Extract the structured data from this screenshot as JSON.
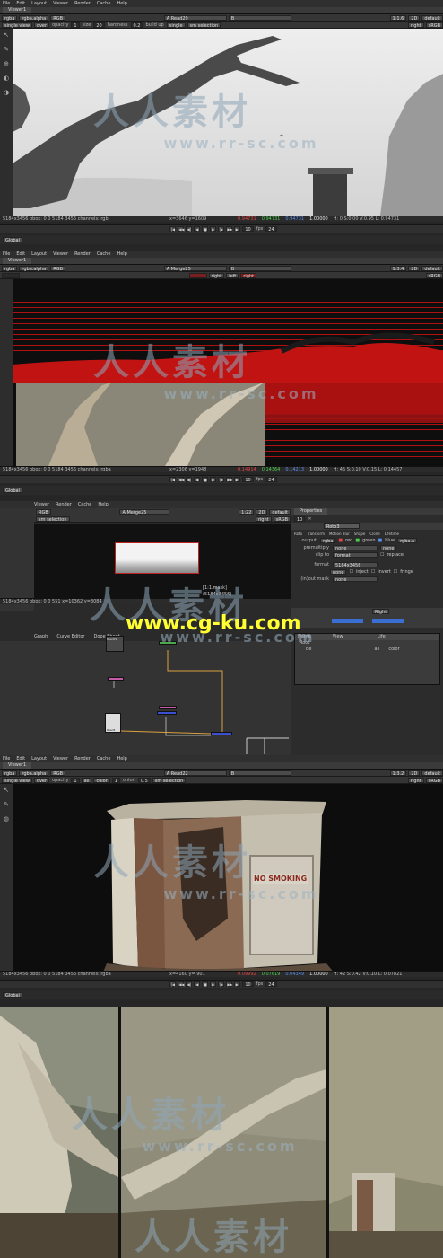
{
  "menu": [
    "File",
    "Edit",
    "Layout",
    "Viewer",
    "Render",
    "Cache",
    "Help"
  ],
  "viewer_tab": "Viewer1",
  "global_label": "Global",
  "fps_label": "fps",
  "fps_value": "24",
  "frame_value": "10",
  "panel1": {
    "row1": [
      "rgba",
      "rgba.alpha",
      "RGB"
    ],
    "input_a": "A  Read29",
    "input_b": "B",
    "zoom": "1:1.6",
    "view": "2D",
    "lut": "default",
    "row2": [
      "single view",
      "over",
      "opacity",
      "1",
      "size",
      "20",
      "hardness",
      "0.2",
      "build up",
      "single",
      "sm selection"
    ],
    "side": "right",
    "colorspace": "sRGB",
    "status_info": "5184x3456 bbox: 0 0 5184 3456 channels: rgb",
    "coords": "x=3646 y=1609",
    "pixel": [
      "0.94731",
      "0.94731",
      "0.94731",
      "1.00000"
    ],
    "hsvl": "H: 0 S:0.00 V:0.95  L: 0.94731"
  },
  "panel2": {
    "row1": [
      "rgba",
      "rgba.alpha",
      "RGB"
    ],
    "input_a": "A  Merge25",
    "input_b": "B",
    "zoom": "1:3.4",
    "view": "2D",
    "lut": "default",
    "side_labels": [
      "right",
      "left",
      "right"
    ],
    "colorspace": "sRGB",
    "status_info": "5184x3456 bbox: 0 0 5184 3456 channels: rgba",
    "coords": "x=2306 y=1948",
    "pixel": [
      "0.14914",
      "0.14364",
      "0.14213",
      "1.00000"
    ],
    "hsvl": "H: 45 S:0.10 V:0.15  L: 0.14457"
  },
  "panel3": {
    "row1": [
      "RGB"
    ],
    "input_a": "A  Merge25",
    "zoom": "1:22",
    "view": "2D",
    "lut": "default",
    "selection": "sm selection",
    "side": "right",
    "colorspace": "sRGB",
    "status_info": "5184x3456 bbox: 0 0 551 x=10362 y=3084",
    "node_tabs": [
      "Graph",
      "Curve Editor",
      "Dope Sheet"
    ],
    "mask_text": "[1:1.mask]",
    "mask_size": "(5184x3456)",
    "properties_title": "Properties",
    "properties_count": "10",
    "node_name": "Roto3",
    "prop_tabs": [
      "Roto",
      "Transform",
      "Motion Blur",
      "Shape",
      "Clone",
      "Lifetime"
    ],
    "output_label": "output",
    "output_value": "rgba",
    "channels": [
      "red",
      "green",
      "blue",
      "rgba.a"
    ],
    "premultiply_label": "premultiply",
    "premultiply_value": "none",
    "clip_label": "clip to",
    "clip_value": "format",
    "replace_label": "replace",
    "format_label": "format",
    "format_value": "5184x3456",
    "mask_opt": "none",
    "invert_label": "invert",
    "fringe_label": "fringe",
    "inject_label": "inject",
    "inout_label": "(in)out mask",
    "inout_value": "none",
    "right_sel": "Right",
    "tree_headers": [
      "Name",
      "View",
      "Life"
    ],
    "tree_root": "Root",
    "tree_child": "Be",
    "tree_color": "color",
    "tree_all": "all",
    "nodes": [
      "Read29",
      "Read3"
    ],
    "overlay_url": "www.cg-ku.com"
  },
  "panel4": {
    "row1": [
      "rgba",
      "rgba.alpha",
      "RGB"
    ],
    "input_a": "A  Read22",
    "input_b": "B",
    "zoom": "1:3.2",
    "view": "2D",
    "lut": "default",
    "row2": [
      "single view",
      "over",
      "opacity",
      "1",
      "all",
      "color",
      "1",
      "onion",
      "0.5",
      "sm selection"
    ],
    "side": "right",
    "colorspace": "sRGB",
    "sign_text": "NO SMOKING",
    "status_info": "5184x3456 bbox: 0 0 5184 3456 channels: rgba",
    "coords": "x=4160 y= 901",
    "pixel": [
      "0.09992",
      "0.07619",
      "0.04349",
      "1.00000"
    ],
    "hsvl": "H: 42 S:0.42 V:0.10  L: 0.07821"
  },
  "watermark": {
    "cn": "人人素材",
    "url": "www.rr-sc.com"
  },
  "colors": {
    "red_channel": "#e04646",
    "green_channel": "#4bd04b",
    "blue_channel": "#5a8ef0",
    "node_pink": "#c45ca8",
    "node_blue": "#3b4fd0",
    "node_green": "#4ca84c",
    "overlay_yellow": "#ffff33"
  }
}
